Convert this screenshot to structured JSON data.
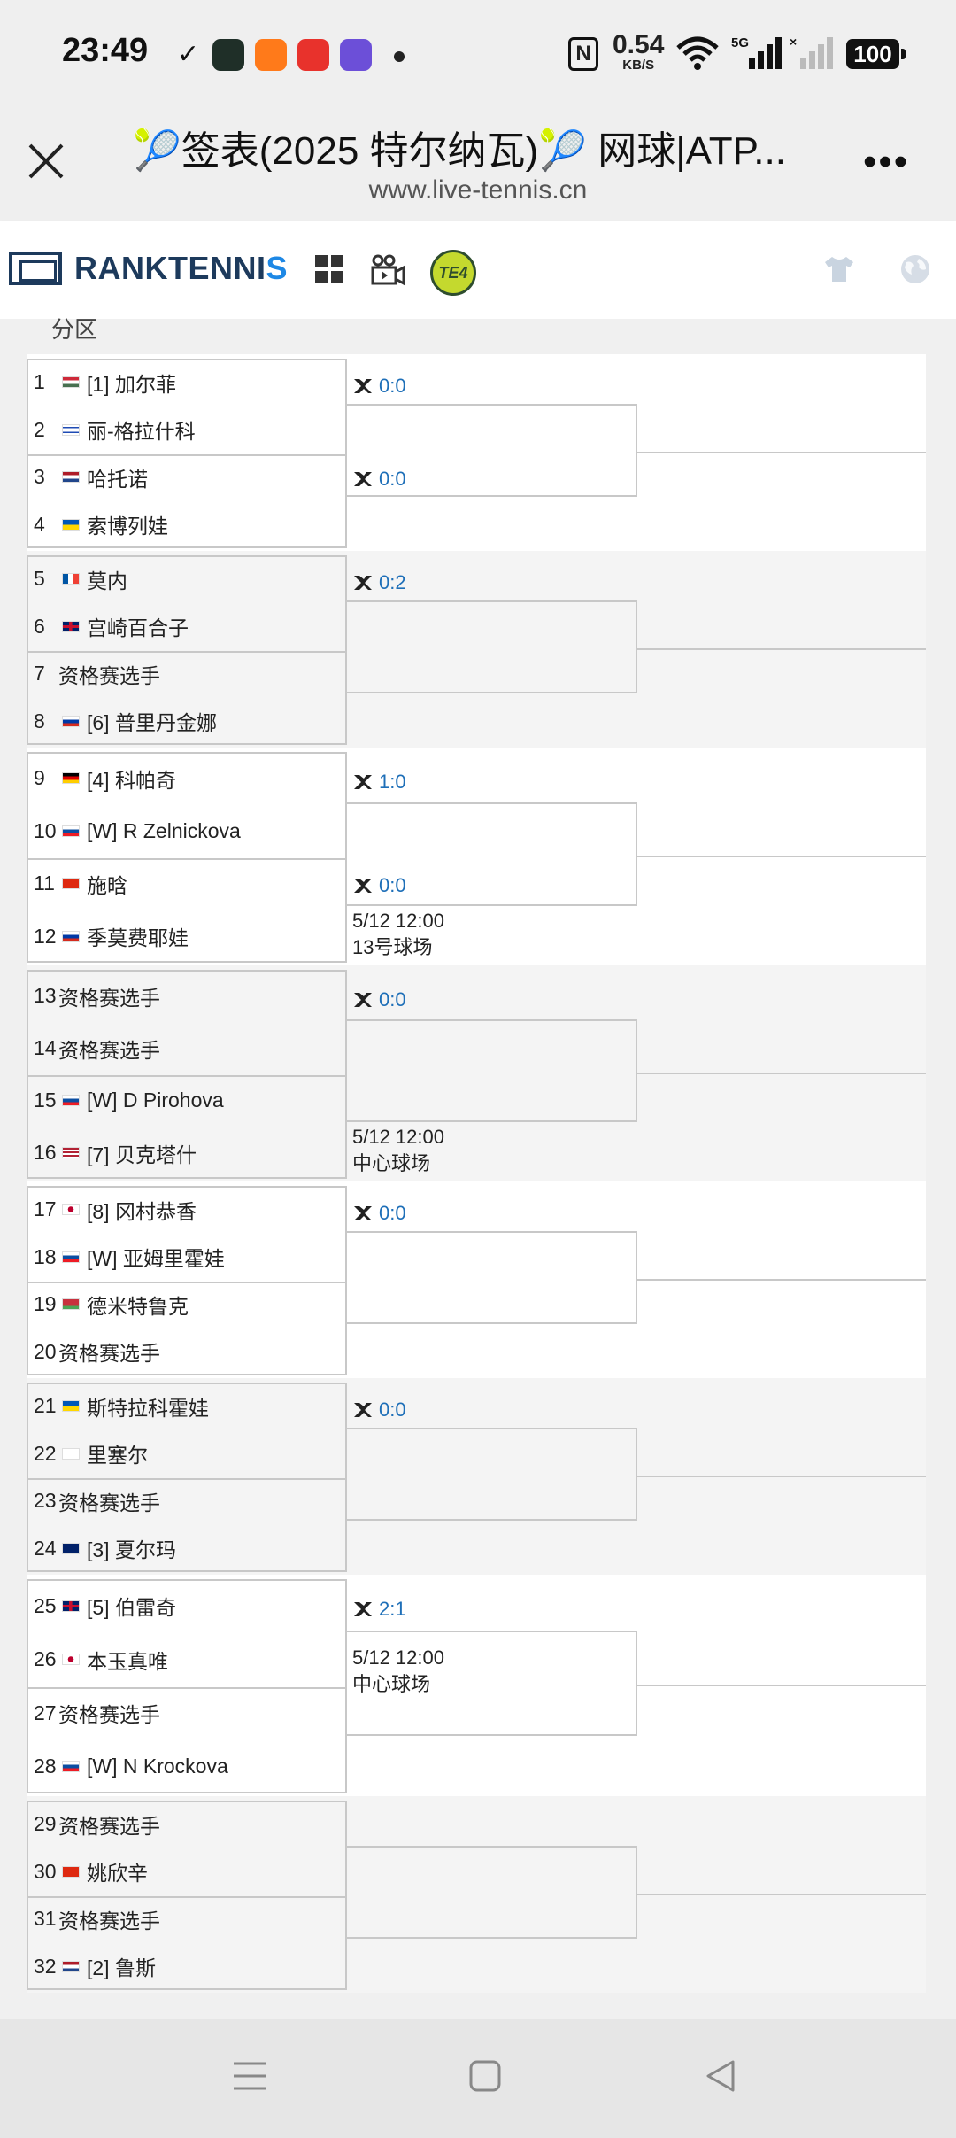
{
  "status_bar": {
    "time": "23:49",
    "check": "✓",
    "nfc": "N",
    "speed_value": "0.54",
    "speed_unit": "KB/S",
    "network": "5G",
    "battery": "100"
  },
  "browser": {
    "title": "🎾签表(2025 特尔纳瓦)🎾 网球|ATP...",
    "url": "www.live-tennis.cn",
    "more": "•••"
  },
  "site": {
    "logo_main": "RANKTENNI",
    "logo_tail": "S",
    "te4_badge": "TE4"
  },
  "section_label": "分区",
  "groups": [
    {
      "players": [
        {
          "num": "1",
          "flag": "hu",
          "name": "[1] 加尔菲"
        },
        {
          "num": "2",
          "flag": "il",
          "name": "丽-格拉什科"
        },
        {
          "num": "3",
          "flag": "nl",
          "name": "哈托诺"
        },
        {
          "num": "4",
          "flag": "ua",
          "name": "索博列娃"
        }
      ],
      "scores": [
        "0:0",
        "0:0"
      ],
      "info": []
    },
    {
      "players": [
        {
          "num": "5",
          "flag": "fr",
          "name": "莫内"
        },
        {
          "num": "6",
          "flag": "gb",
          "name": "宫崎百合子"
        },
        {
          "num": "7",
          "flag": "",
          "name": "资格赛选手"
        },
        {
          "num": "8",
          "flag": "ru",
          "name": "[6] 普里丹金娜"
        }
      ],
      "scores": [
        "0:2"
      ],
      "info": []
    },
    {
      "players": [
        {
          "num": "9",
          "flag": "de",
          "name": "[4] 科帕奇"
        },
        {
          "num": "10",
          "flag": "sk",
          "name": "[W] R Zelnickova"
        },
        {
          "num": "11",
          "flag": "cn",
          "name": "施晗"
        },
        {
          "num": "12",
          "flag": "ru",
          "name": "季莫费耶娃"
        }
      ],
      "scores": [
        "1:0",
        "0:0"
      ],
      "info": [
        "5/12 12:00",
        "13号球场"
      ]
    },
    {
      "players": [
        {
          "num": "13",
          "flag": "",
          "name": "资格赛选手"
        },
        {
          "num": "14",
          "flag": "",
          "name": "资格赛选手"
        },
        {
          "num": "15",
          "flag": "sk",
          "name": "[W] D Pirohova"
        },
        {
          "num": "16",
          "flag": "us",
          "name": "[7] 贝克塔什"
        }
      ],
      "scores": [
        "0:0"
      ],
      "info": [
        "5/12 12:00",
        "中心球场"
      ]
    },
    {
      "players": [
        {
          "num": "17",
          "flag": "jp",
          "name": "[8] 冈村恭香"
        },
        {
          "num": "18",
          "flag": "sk",
          "name": "[W] 亚姆里霍娃"
        },
        {
          "num": "19",
          "flag": "by",
          "name": "德米特鲁克"
        },
        {
          "num": "20",
          "flag": "",
          "name": "资格赛选手"
        }
      ],
      "scores": [
        "0:0"
      ],
      "info": []
    },
    {
      "players": [
        {
          "num": "21",
          "flag": "ua",
          "name": "斯特拉科霍娃"
        },
        {
          "num": "22",
          "flag": "ch",
          "name": "里塞尔"
        },
        {
          "num": "23",
          "flag": "",
          "name": "资格赛选手"
        },
        {
          "num": "24",
          "flag": "au",
          "name": "[3] 夏尔玛"
        }
      ],
      "scores": [
        "0:0"
      ],
      "info": []
    },
    {
      "players": [
        {
          "num": "25",
          "flag": "gb",
          "name": "[5] 伯雷奇"
        },
        {
          "num": "26",
          "flag": "jp",
          "name": "本玉真唯"
        },
        {
          "num": "27",
          "flag": "",
          "name": "资格赛选手"
        },
        {
          "num": "28",
          "flag": "sk",
          "name": "[W] N Krockova"
        }
      ],
      "scores": [
        "2:1"
      ],
      "info": [
        "5/12 12:00",
        "中心球场"
      ]
    },
    {
      "players": [
        {
          "num": "29",
          "flag": "",
          "name": "资格赛选手"
        },
        {
          "num": "30",
          "flag": "cn",
          "name": "姚欣辛"
        },
        {
          "num": "31",
          "flag": "",
          "name": "资格赛选手"
        },
        {
          "num": "32",
          "flag": "nl",
          "name": "[2] 鲁斯"
        }
      ],
      "scores": [],
      "info": []
    }
  ],
  "colors": {
    "score_blue": "#1e6fb8",
    "logo_navy": "#1d3a5c",
    "logo_accent": "#1e88e5",
    "te4_green": "#c4d92e"
  }
}
